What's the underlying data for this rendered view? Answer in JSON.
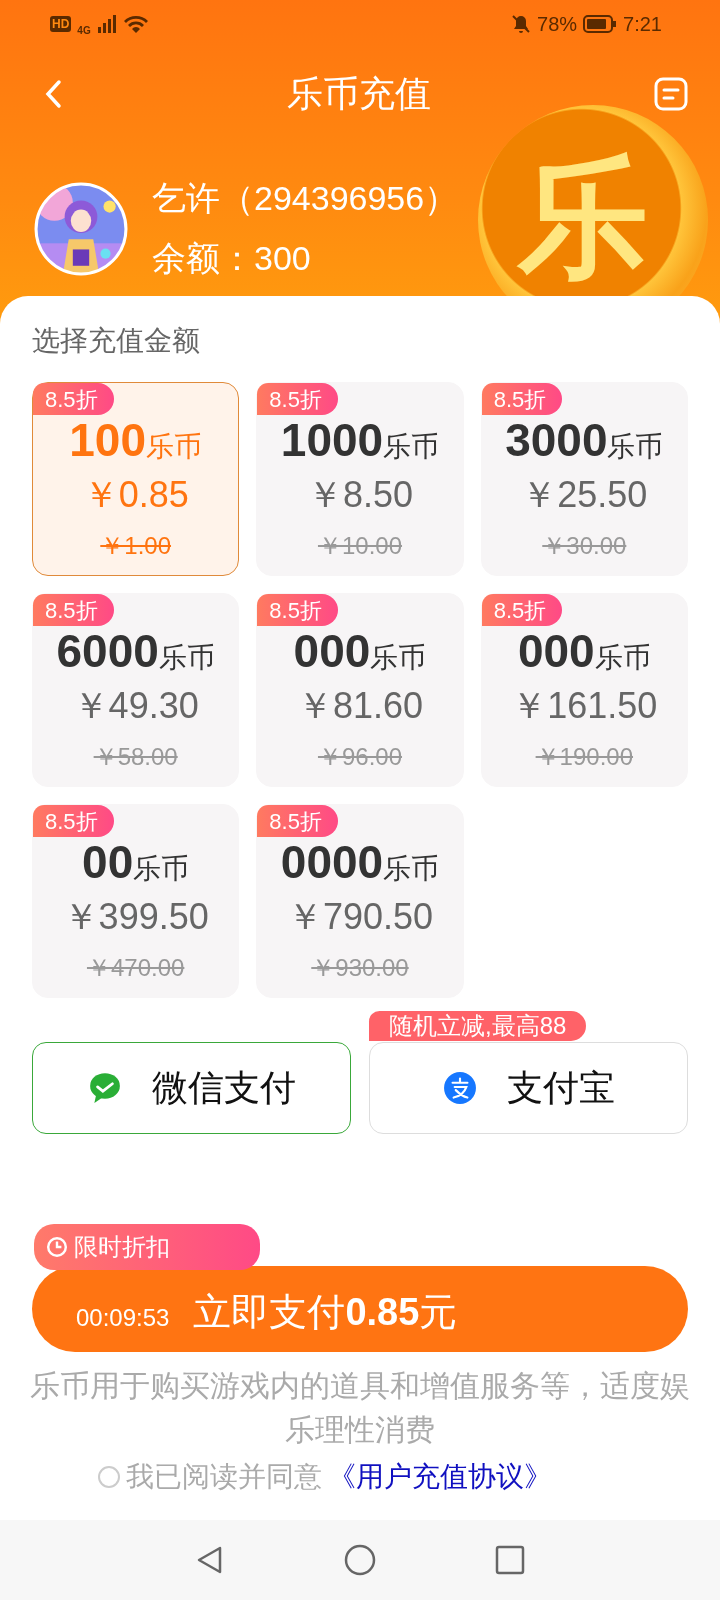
{
  "status_bar": {
    "hd": "HD",
    "network": "4G",
    "battery_percent": "78%",
    "time": "7:21"
  },
  "header": {
    "title": "乐币充值",
    "coin_glyph": "乐"
  },
  "user": {
    "name": "乞许（294396956）",
    "balance": "余额：300"
  },
  "section_title": "选择充值金额",
  "packages": [
    {
      "badge": "8.5折",
      "amount": "**100**乐币",
      "price": "￥0.85",
      "original_price": "￥1.00",
      "selected": true
    },
    {
      "badge": "8.5折",
      "amount": "**1000**乐币",
      "price": "￥8.50",
      "original_price": "￥10.00",
      "selected": false
    },
    {
      "badge": "8.5折",
      "amount": "**3000**乐币",
      "price": "￥25.50",
      "original_price": "￥30.00",
      "selected": false
    },
    {
      "badge": "8.5折",
      "amount": "**6000**乐币",
      "price": "￥49.30",
      "original_price": "￥58.00",
      "selected": false
    },
    {
      "badge": "8.5折",
      "amount": "**000**乐币",
      "price": "￥81.60",
      "original_price": "￥96.00",
      "selected": false
    },
    {
      "badge": "8.5折",
      "amount": "**000**乐币",
      "price": "￥161.50",
      "original_price": "￥190.00",
      "selected": false
    },
    {
      "badge": "8.5折",
      "amount": "**00**乐币",
      "price": "￥399.50",
      "original_price": "￥470.00",
      "selected": false
    },
    {
      "badge": "8.5折",
      "amount": "**0000**乐币",
      "price": "￥790.50",
      "original_price": "￥930.00",
      "selected": false
    }
  ],
  "payment_methods": [
    {
      "kind": "wechat",
      "label": "微信支付",
      "selected": true
    },
    {
      "kind": "alipay",
      "label": "支付宝",
      "selected": false,
      "promo": "随机立减,最高88"
    }
  ],
  "pay": {
    "tooltip": "限时折扣",
    "countdown": "00:09:53",
    "label": "立即支付**0.85**元"
  },
  "disclaimer": "乐币用于购买游戏内的道具和增值服务等，适度娱乐理性消费",
  "agreement": {
    "checked": false,
    "text": "我已阅读并同意",
    "link": "《用户充值协议》"
  }
}
